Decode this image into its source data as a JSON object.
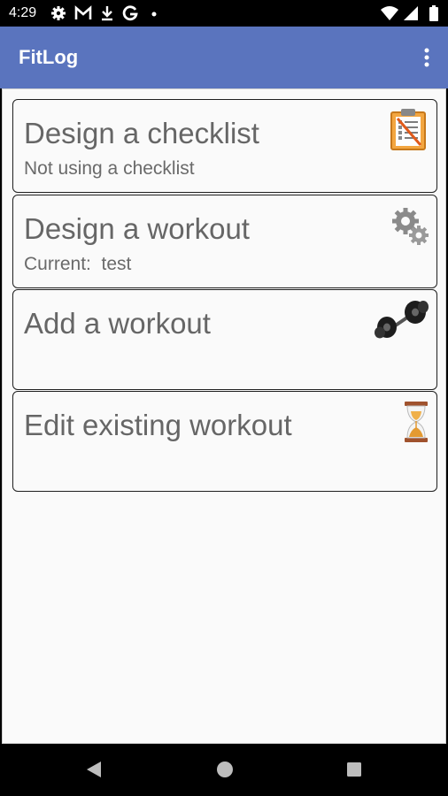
{
  "status_bar": {
    "time": "4:29",
    "notification_icons": [
      "gear-icon",
      "gmail-icon",
      "download-icon",
      "google-icon",
      "dot-icon"
    ],
    "system_icons": [
      "wifi-icon",
      "signal-icon",
      "battery-icon"
    ]
  },
  "app_bar": {
    "title": "FitLog",
    "background_color": "#5a74be",
    "menu_icon": "overflow-menu-icon"
  },
  "menu_items": [
    {
      "title": "Design a checklist",
      "subtitle": "Not using a checklist",
      "icon": "checklist-icon"
    },
    {
      "title": "Design a workout",
      "subtitle": "Current:  test",
      "icon": "gears-icon"
    },
    {
      "title": "Add a workout",
      "subtitle": "",
      "icon": "dumbbell-icon"
    },
    {
      "title": "Edit existing workout",
      "subtitle": "",
      "icon": "hourglass-icon"
    }
  ],
  "nav_bar": {
    "buttons": [
      "back-icon",
      "home-icon",
      "recents-icon"
    ]
  }
}
